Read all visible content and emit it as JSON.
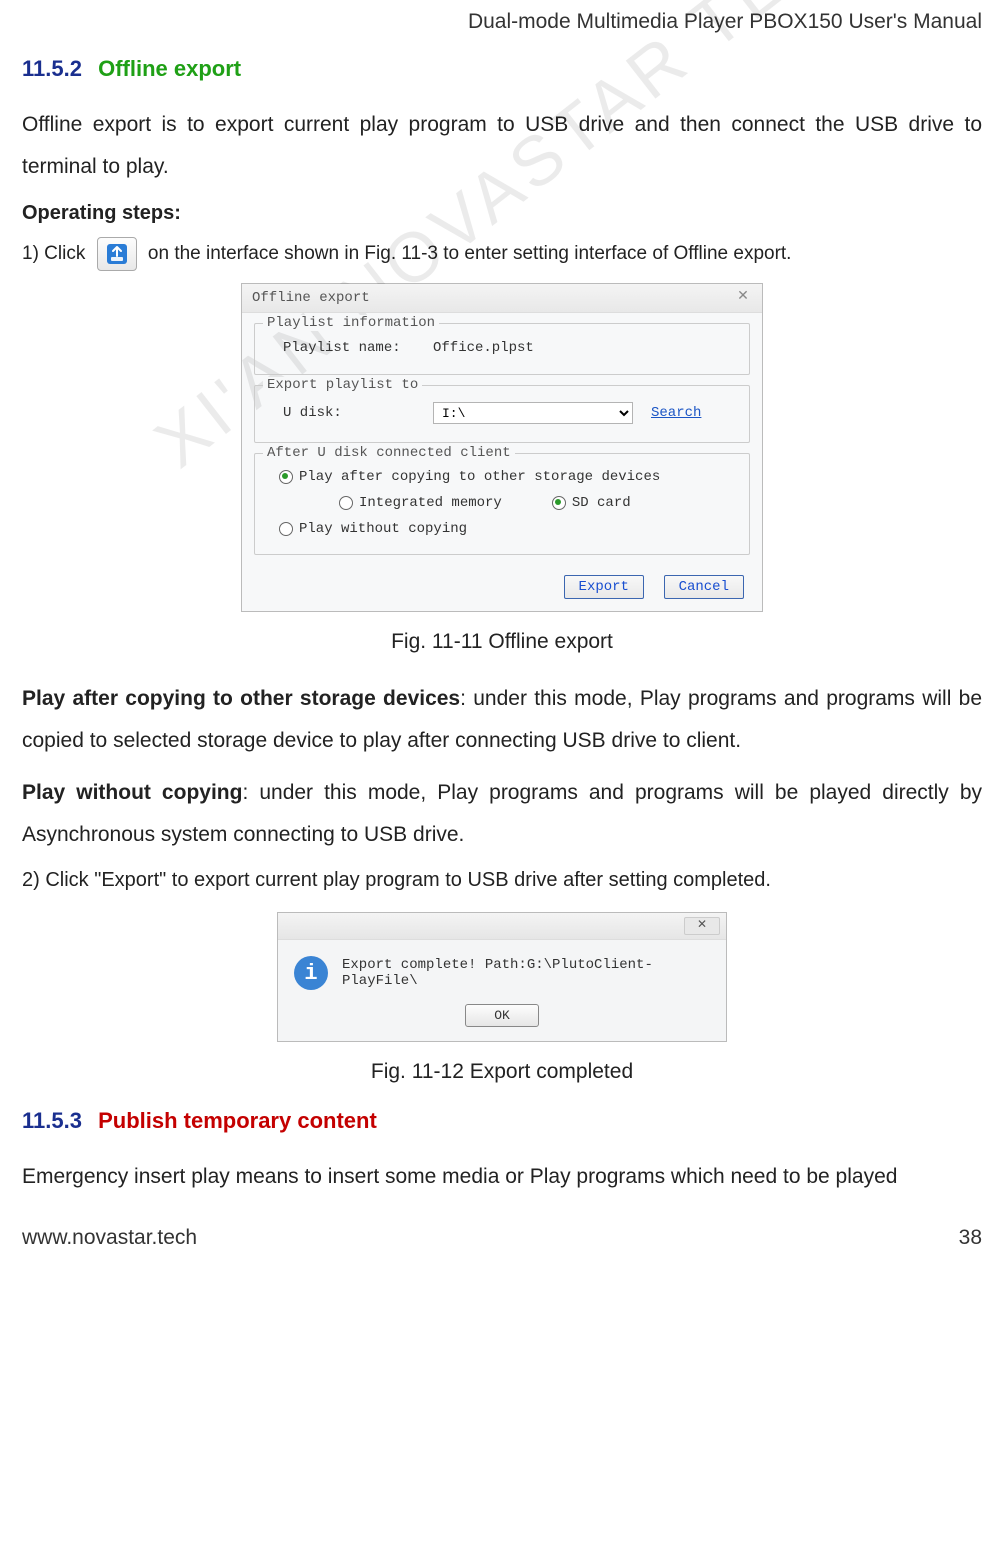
{
  "header": {
    "doc_title": "Dual-mode Multimedia Player PBOX150 User's Manual"
  },
  "section1": {
    "number": "11.5.2",
    "title": "Offline export",
    "intro": "Offline export is to export current play program to USB drive and then connect the USB drive to terminal to play.",
    "op_steps_label": "Operating steps:",
    "step1_pre": "1) Click",
    "step1_post": " on the interface shown in Fig. 11-3 to enter setting interface of Offline export.",
    "fig1_caption": "Fig. 11-11 Offline export",
    "mode1_title": "Play after copying to other storage devices",
    "mode1_rest": ": under this mode, Play programs and programs will be copied to selected storage device to play after connecting USB drive to client.",
    "mode2_title": "Play without copying",
    "mode2_rest": ": under this mode, Play programs and programs will be played directly by Asynchronous system connecting to USB drive.",
    "step2": "2) Click \"Export\" to export current play program to USB drive after setting completed.",
    "fig2_caption": "Fig. 11-12 Export completed"
  },
  "dialog1": {
    "title": "Offline export",
    "group1_legend": "Playlist information",
    "playlist_name_label": "Playlist name:",
    "playlist_name_value": "Office.plpst",
    "group2_legend": "Export playlist to",
    "udisk_label": "U disk:",
    "udisk_value": "I:\\",
    "search_link": "Search",
    "group3_legend": "After U disk connected client",
    "radio_copy": "Play after copying to other storage devices",
    "radio_integrated": "Integrated memory",
    "radio_sd": "SD card",
    "radio_nocopy": "Play without copying",
    "btn_export": "Export",
    "btn_cancel": "Cancel"
  },
  "dialog2": {
    "message": "Export complete! Path:G:\\PlutoClient-PlayFile\\",
    "btn_ok": "OK"
  },
  "section2": {
    "number": "11.5.3",
    "title": "Publish temporary content",
    "intro": "Emergency insert play means to insert some media or Play programs which need to be played"
  },
  "footer": {
    "url": "www.novastar.tech",
    "page": "38"
  },
  "watermark": "XI'AN NOVASTAR TECH CO., LTD"
}
